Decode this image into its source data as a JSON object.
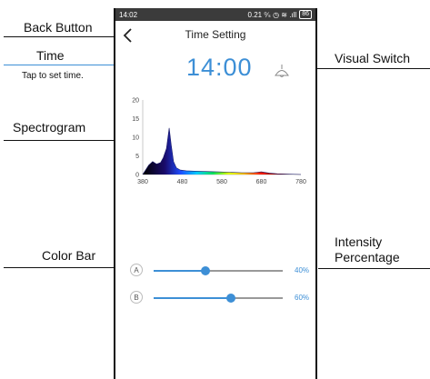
{
  "annotations": {
    "back_button": "Back Button",
    "time": "Time",
    "tap_hint": "Tap to set time.",
    "spectrogram": "Spectrogram",
    "color_bar": "Color Bar",
    "visual_switch": "Visual Switch",
    "intensity_line1": "Intensity",
    "intensity_line2": "Percentage"
  },
  "status_bar": {
    "time": "14:02",
    "info": "0.21 ⁰∕ₛ ◷ ≋ .ıll",
    "battery": "86"
  },
  "header": {
    "title": "Time Setting"
  },
  "clock": {
    "value": "14:00"
  },
  "icons": {
    "back": "chevron-left-icon",
    "switch": "lamp-icon"
  },
  "chart_data": {
    "type": "area",
    "xlim": [
      380,
      780
    ],
    "ylim": [
      0,
      20
    ],
    "x_ticks": [
      "380",
      "480",
      "580",
      "680",
      "780"
    ],
    "y_ticks": [
      "0",
      "5",
      "10",
      "15",
      "20"
    ],
    "x": [
      380,
      395,
      405,
      415,
      425,
      432,
      440,
      447,
      452,
      458,
      465,
      475,
      490,
      510,
      540,
      570,
      600,
      630,
      660,
      680,
      700,
      720,
      780
    ],
    "y": [
      0,
      2.5,
      3.5,
      2.8,
      3.2,
      4.5,
      7,
      12.5,
      8,
      3.5,
      1.8,
      1.2,
      1.0,
      0.9,
      0.8,
      0.7,
      0.6,
      0.5,
      0.5,
      0.7,
      0.4,
      0.2,
      0
    ]
  },
  "sliders": [
    {
      "channel": "A",
      "value": 0.4,
      "label": "40%"
    },
    {
      "channel": "B",
      "value": 0.6,
      "label": "60%"
    }
  ]
}
